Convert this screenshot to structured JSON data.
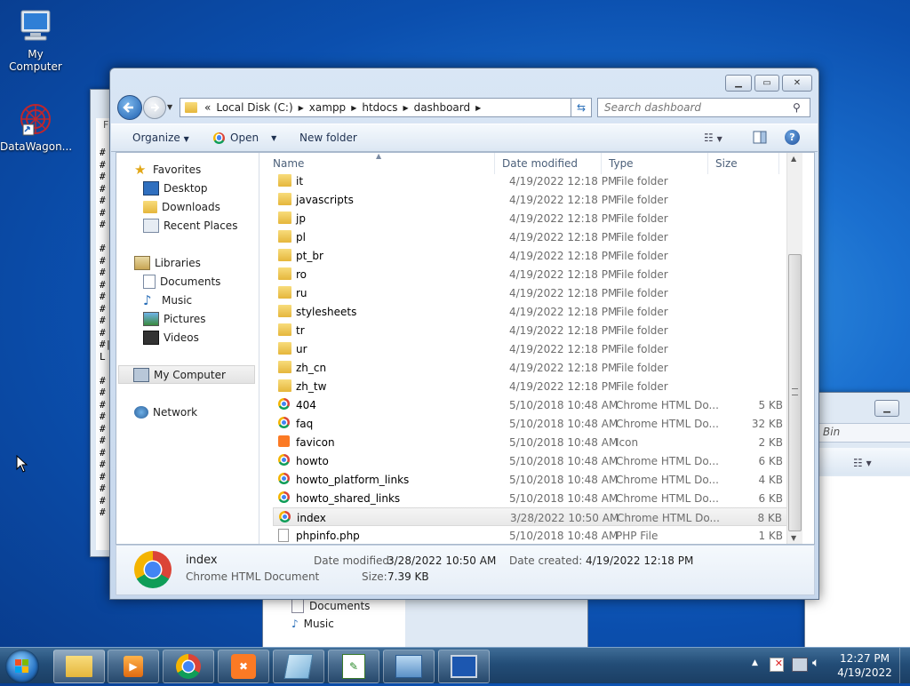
{
  "desktop": {
    "icons": [
      {
        "label": "My Computer"
      },
      {
        "label": "DataWagon..."
      }
    ]
  },
  "bg_window": {
    "hash_lines": [
      "#",
      "#",
      "#",
      "#",
      "#",
      "#",
      "#",
      "",
      "#",
      "#",
      "#",
      "#",
      "#",
      "#",
      "#",
      "#",
      "#|",
      "L",
      "",
      "#",
      "#",
      "#",
      "#",
      "#",
      "#",
      "#",
      "#",
      "#",
      "#",
      "#",
      "#"
    ],
    "partial_menu": "F",
    "right_window_text": "Bin",
    "bottom_items": [
      "Documents",
      "Music"
    ]
  },
  "explorer": {
    "address": {
      "overflow": "«",
      "crumbs": [
        "Local Disk (C:)",
        "xampp",
        "htdocs",
        "dashboard"
      ]
    },
    "search_placeholder": "Search dashboard",
    "toolbar": {
      "organize": "Organize",
      "open": "Open",
      "new_folder": "New folder"
    },
    "nav": {
      "favorites": "Favorites",
      "desktop": "Desktop",
      "downloads": "Downloads",
      "recent": "Recent Places",
      "libraries": "Libraries",
      "documents": "Documents",
      "music": "Music",
      "pictures": "Pictures",
      "videos": "Videos",
      "computer": "My Computer",
      "network": "Network"
    },
    "columns": {
      "name": "Name",
      "date": "Date modified",
      "type": "Type",
      "size": "Size"
    },
    "files": [
      {
        "name": "it",
        "date": "4/19/2022 12:18 PM",
        "type": "File folder",
        "size": "",
        "icon": "folder-icon"
      },
      {
        "name": "javascripts",
        "date": "4/19/2022 12:18 PM",
        "type": "File folder",
        "size": "",
        "icon": "folder-icon"
      },
      {
        "name": "jp",
        "date": "4/19/2022 12:18 PM",
        "type": "File folder",
        "size": "",
        "icon": "folder-icon"
      },
      {
        "name": "pl",
        "date": "4/19/2022 12:18 PM",
        "type": "File folder",
        "size": "",
        "icon": "folder-icon"
      },
      {
        "name": "pt_br",
        "date": "4/19/2022 12:18 PM",
        "type": "File folder",
        "size": "",
        "icon": "folder-icon"
      },
      {
        "name": "ro",
        "date": "4/19/2022 12:18 PM",
        "type": "File folder",
        "size": "",
        "icon": "folder-icon"
      },
      {
        "name": "ru",
        "date": "4/19/2022 12:18 PM",
        "type": "File folder",
        "size": "",
        "icon": "folder-icon"
      },
      {
        "name": "stylesheets",
        "date": "4/19/2022 12:18 PM",
        "type": "File folder",
        "size": "",
        "icon": "folder-icon"
      },
      {
        "name": "tr",
        "date": "4/19/2022 12:18 PM",
        "type": "File folder",
        "size": "",
        "icon": "folder-icon"
      },
      {
        "name": "ur",
        "date": "4/19/2022 12:18 PM",
        "type": "File folder",
        "size": "",
        "icon": "folder-icon"
      },
      {
        "name": "zh_cn",
        "date": "4/19/2022 12:18 PM",
        "type": "File folder",
        "size": "",
        "icon": "folder-icon"
      },
      {
        "name": "zh_tw",
        "date": "4/19/2022 12:18 PM",
        "type": "File folder",
        "size": "",
        "icon": "folder-icon"
      },
      {
        "name": "404",
        "date": "5/10/2018 10:48 AM",
        "type": "Chrome HTML Do...",
        "size": "5 KB",
        "icon": "chrome-icon"
      },
      {
        "name": "faq",
        "date": "5/10/2018 10:48 AM",
        "type": "Chrome HTML Do...",
        "size": "32 KB",
        "icon": "chrome-icon"
      },
      {
        "name": "favicon",
        "date": "5/10/2018 10:48 AM",
        "type": "Icon",
        "size": "2 KB",
        "icon": "xampp-icon"
      },
      {
        "name": "howto",
        "date": "5/10/2018 10:48 AM",
        "type": "Chrome HTML Do...",
        "size": "6 KB",
        "icon": "chrome-icon"
      },
      {
        "name": "howto_platform_links",
        "date": "5/10/2018 10:48 AM",
        "type": "Chrome HTML Do...",
        "size": "4 KB",
        "icon": "chrome-icon"
      },
      {
        "name": "howto_shared_links",
        "date": "5/10/2018 10:48 AM",
        "type": "Chrome HTML Do...",
        "size": "6 KB",
        "icon": "chrome-icon"
      },
      {
        "name": "index",
        "date": "3/28/2022 10:50 AM",
        "type": "Chrome HTML Do...",
        "size": "8 KB",
        "icon": "chrome-icon",
        "selected": true
      },
      {
        "name": "phpinfo.php",
        "date": "5/10/2018 10:48 AM",
        "type": "PHP File",
        "size": "1 KB",
        "icon": "file-icon"
      }
    ],
    "details": {
      "name": "index",
      "type": "Chrome HTML Document",
      "modified_label": "Date modified:",
      "modified_value": "3/28/2022 10:50 AM",
      "created_label": "Date created:",
      "created_value": "4/19/2022 12:18 PM",
      "size_label": "Size:",
      "size_value": "7.39 KB"
    }
  },
  "taskbar": {
    "time": "12:27 PM",
    "date": "4/19/2022"
  }
}
